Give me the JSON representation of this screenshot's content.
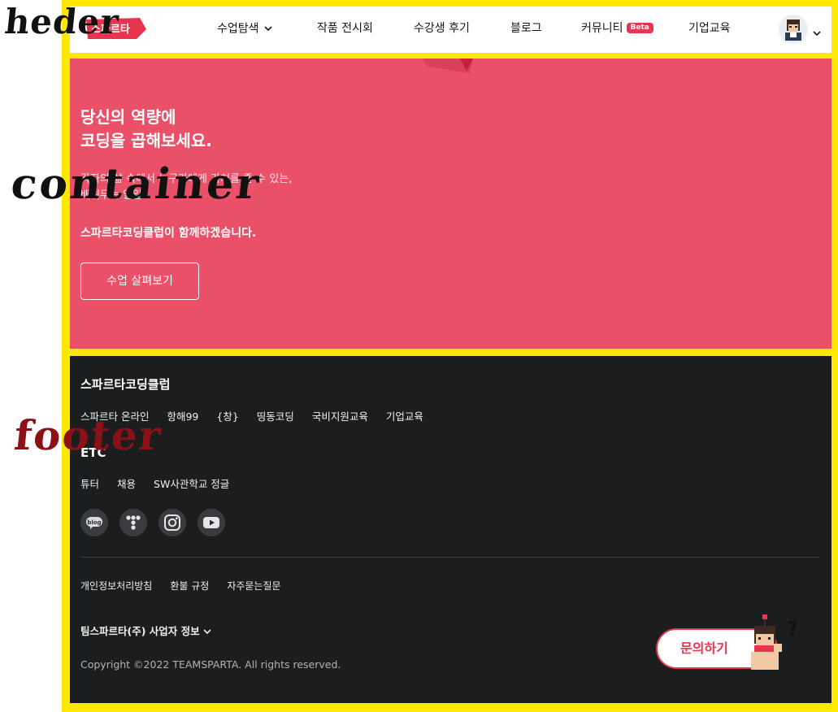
{
  "header": {
    "logo_text": "스파르타",
    "nav": [
      {
        "label": "수업탐색",
        "has_dropdown": true
      },
      {
        "label": "작품 전시회"
      },
      {
        "label": "수강생 후기"
      },
      {
        "label": "블로그"
      },
      {
        "label": "커뮤니티",
        "badge": "Beta"
      },
      {
        "label": "기업교육"
      }
    ]
  },
  "hero": {
    "title_line1": "당신의 역량에",
    "title_line2": "코딩을 곱해보세요.",
    "desc_line1": "각자의 삶 속에서 누구가에게 가치를 줄 수 있는,",
    "desc_line2": "배워두는 일일",
    "subtitle": "스파르타코딩클럽이 함께하겠습니다.",
    "cta": "수업 살펴보기"
  },
  "annotations": {
    "header": "heder",
    "container": "container",
    "footer": "footer"
  },
  "footer": {
    "brand": "스파르타코딩클럽",
    "links": [
      "스파르타 온라인",
      "항해99",
      "{창}",
      "띵동코딩",
      "국비지원교육",
      "기업교육"
    ],
    "brand2": "ETC",
    "links2": [
      "튜터",
      "채용",
      "SW사관학교 정글"
    ],
    "social": [
      {
        "name": "blog",
        "icon": "blog-icon",
        "label": "blog"
      },
      {
        "name": "tistory",
        "icon": "tistory-icon"
      },
      {
        "name": "instagram",
        "icon": "instagram-icon"
      },
      {
        "name": "youtube",
        "icon": "youtube-icon"
      }
    ],
    "policies": [
      "개인정보처리방침",
      "환불 규정",
      "자주묻는질문"
    ],
    "company_info": "팀스파르타(주) 사업자 정보",
    "copyright": "Copyright ©2022 TEAMSPARTA. All rights reserved.",
    "inquiry": "문의하기"
  },
  "colors": {
    "brand_red": "#e8344e",
    "hero_bg": "#ea5169",
    "footer_bg": "#1c1d1f",
    "frame_yellow": "#ffe800",
    "annotation_footer": "#8c1117"
  }
}
